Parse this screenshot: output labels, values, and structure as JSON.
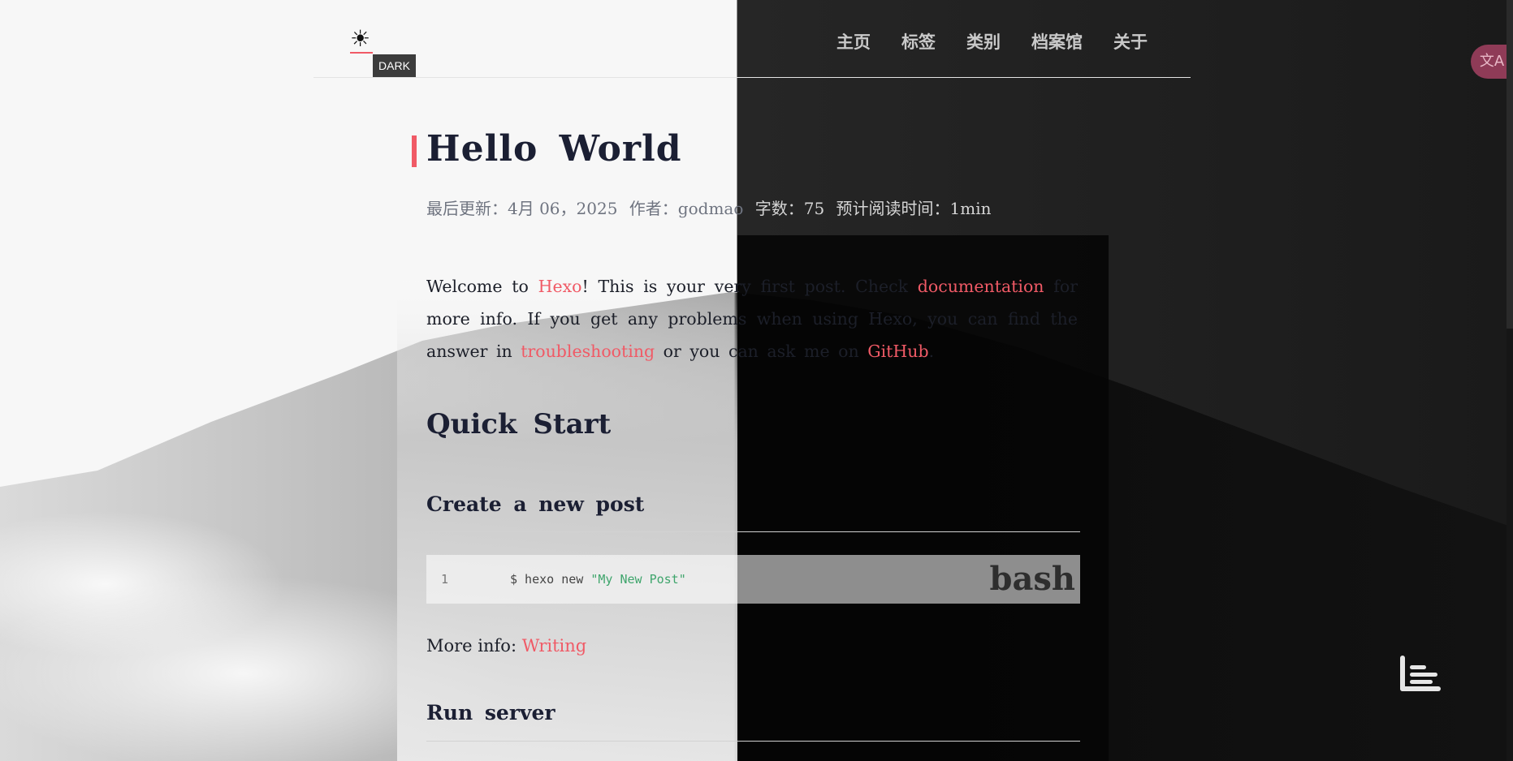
{
  "header": {
    "theme_icon": "sun-icon",
    "tooltip": "DARK",
    "nav": [
      "主页",
      "标签",
      "类别",
      "档案馆",
      "关于"
    ],
    "translate_icon": "translate-icon"
  },
  "post": {
    "title": "Hello World",
    "meta": {
      "updated": "最后更新：4月 06，2025",
      "author": "作者：godmao",
      "words": "字数：75",
      "read_time": "预计阅读时间：1min"
    },
    "intro": {
      "p1": "Welcome to ",
      "link_hexo": "Hexo",
      "p2": "! This is your very first post. Check ",
      "link_docs": "documentation",
      "p3": " for more info. If you get any problems when using Hexo, you can find the answer in ",
      "link_trouble": "troubleshooting",
      "p4": " or you can ask me on ",
      "link_github": "GitHub",
      "p5": "."
    },
    "quick_start": "Quick Start",
    "create_post": "Create a new post",
    "code": {
      "line_no": "1",
      "cmd": "$ hexo new ",
      "str": "\"My New Post\"",
      "lang": "bash"
    },
    "more_info_label": "More info: ",
    "more_info_link": "Writing",
    "run_server": "Run server"
  },
  "widgets": {
    "toc_icon": "toc-list-icon"
  }
}
